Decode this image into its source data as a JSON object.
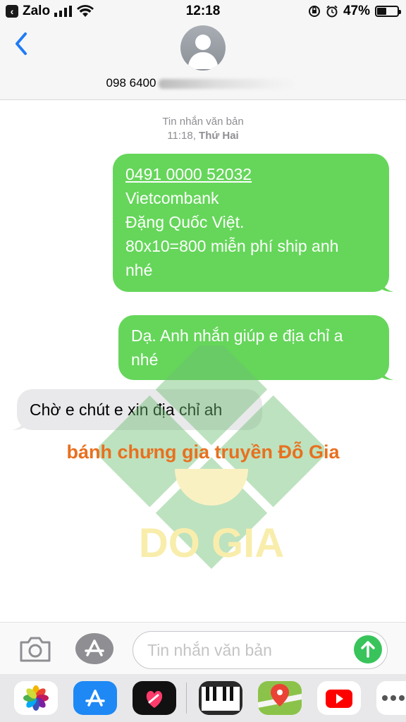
{
  "status_bar": {
    "carrier": "Zalo",
    "time": "12:18",
    "battery_percent": "47%",
    "battery_level": 0.47
  },
  "header": {
    "contact_number": "098 6400"
  },
  "conversation": {
    "meta_label": "Tin nhắn văn bản",
    "meta_time": "11:18,",
    "meta_day": "Thứ Hai",
    "messages": [
      {
        "direction": "sent",
        "lines": [
          "0491 0000 52032",
          "Vietcombank",
          "Đặng Quốc Việt.",
          "80x10=800 miễn phí ship anh",
          "nhé"
        ]
      },
      {
        "direction": "sent",
        "lines": [
          "Dạ. Anh nhắn giúp e địa chỉ a",
          "nhé"
        ]
      },
      {
        "direction": "received",
        "lines": [
          "Chờ e chút e xin địa chỉ ah"
        ]
      }
    ]
  },
  "watermark": {
    "tagline": "bánh chưng gia truyền Đỗ Gia",
    "logo_text": "DO GIA"
  },
  "input_bar": {
    "placeholder": "Tin nhắn văn bản"
  },
  "app_drawer": {
    "apps": [
      "photos-icon",
      "app-store-icon",
      "digital-touch-icon",
      "piano-app-icon",
      "maps-icon",
      "youtube-icon",
      "more-icon"
    ]
  },
  "colors": {
    "sent_bubble": "#65d65a",
    "received_bubble": "#e9e9eb",
    "accent_blue": "#1f7cf6",
    "watermark_orange": "#e8701f",
    "send_green": "#38c45b"
  }
}
